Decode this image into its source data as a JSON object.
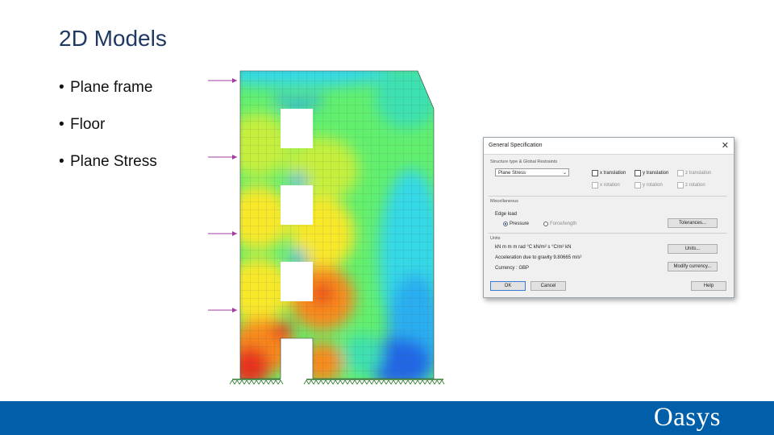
{
  "slide": {
    "title": "2D Models",
    "bullets": [
      "Plane frame",
      "Floor",
      "Plane Stress"
    ]
  },
  "figure": {
    "colors": {
      "red": "#e8321e",
      "orange": "#f88a1c",
      "yellow": "#f8e82c",
      "yellow_green": "#c6ef3c",
      "green": "#62ef6e",
      "teal": "#3ee0b0",
      "cyan": "#34d8e6",
      "sky": "#2aaef0",
      "blue": "#2466e6",
      "load_arrow": "#a03ca0",
      "support": "#2a7a2a"
    },
    "load_arrow_count": 4
  },
  "dialog": {
    "title": "General Specification",
    "close_icon": "close-icon",
    "structure_group_label": "Structure type & Global Restraints",
    "structure_type": "Plane Stress",
    "restraints": [
      {
        "label": "x translation",
        "enabled": true
      },
      {
        "label": "y translation",
        "enabled": true
      },
      {
        "label": "z translation",
        "enabled": false
      },
      {
        "label": "x rotation",
        "enabled": false
      },
      {
        "label": "y rotation",
        "enabled": false
      },
      {
        "label": "z rotation",
        "enabled": false
      }
    ],
    "misc_group_label": "Miscellaneous",
    "edge_load_label": "Edge load",
    "edge_load_options": [
      "Pressure",
      "Force/length"
    ],
    "edge_load_selected": "Pressure",
    "tolerances_button": "Tolerances...",
    "units_group_label": "Units",
    "units_text": "kN m m m rad °C kN/m² s °C/m² kN",
    "acceleration_text": "Acceleration due to gravity 9.80665 m/s²",
    "currency_text": "Currency : GBP",
    "units_button": "Units...",
    "modify_currency_button": "Modify currency...",
    "ok_button": "OK",
    "cancel_button": "Cancel",
    "help_button": "Help"
  },
  "footer": {
    "brand": "Oasys",
    "brand_color": "#005fa8"
  }
}
